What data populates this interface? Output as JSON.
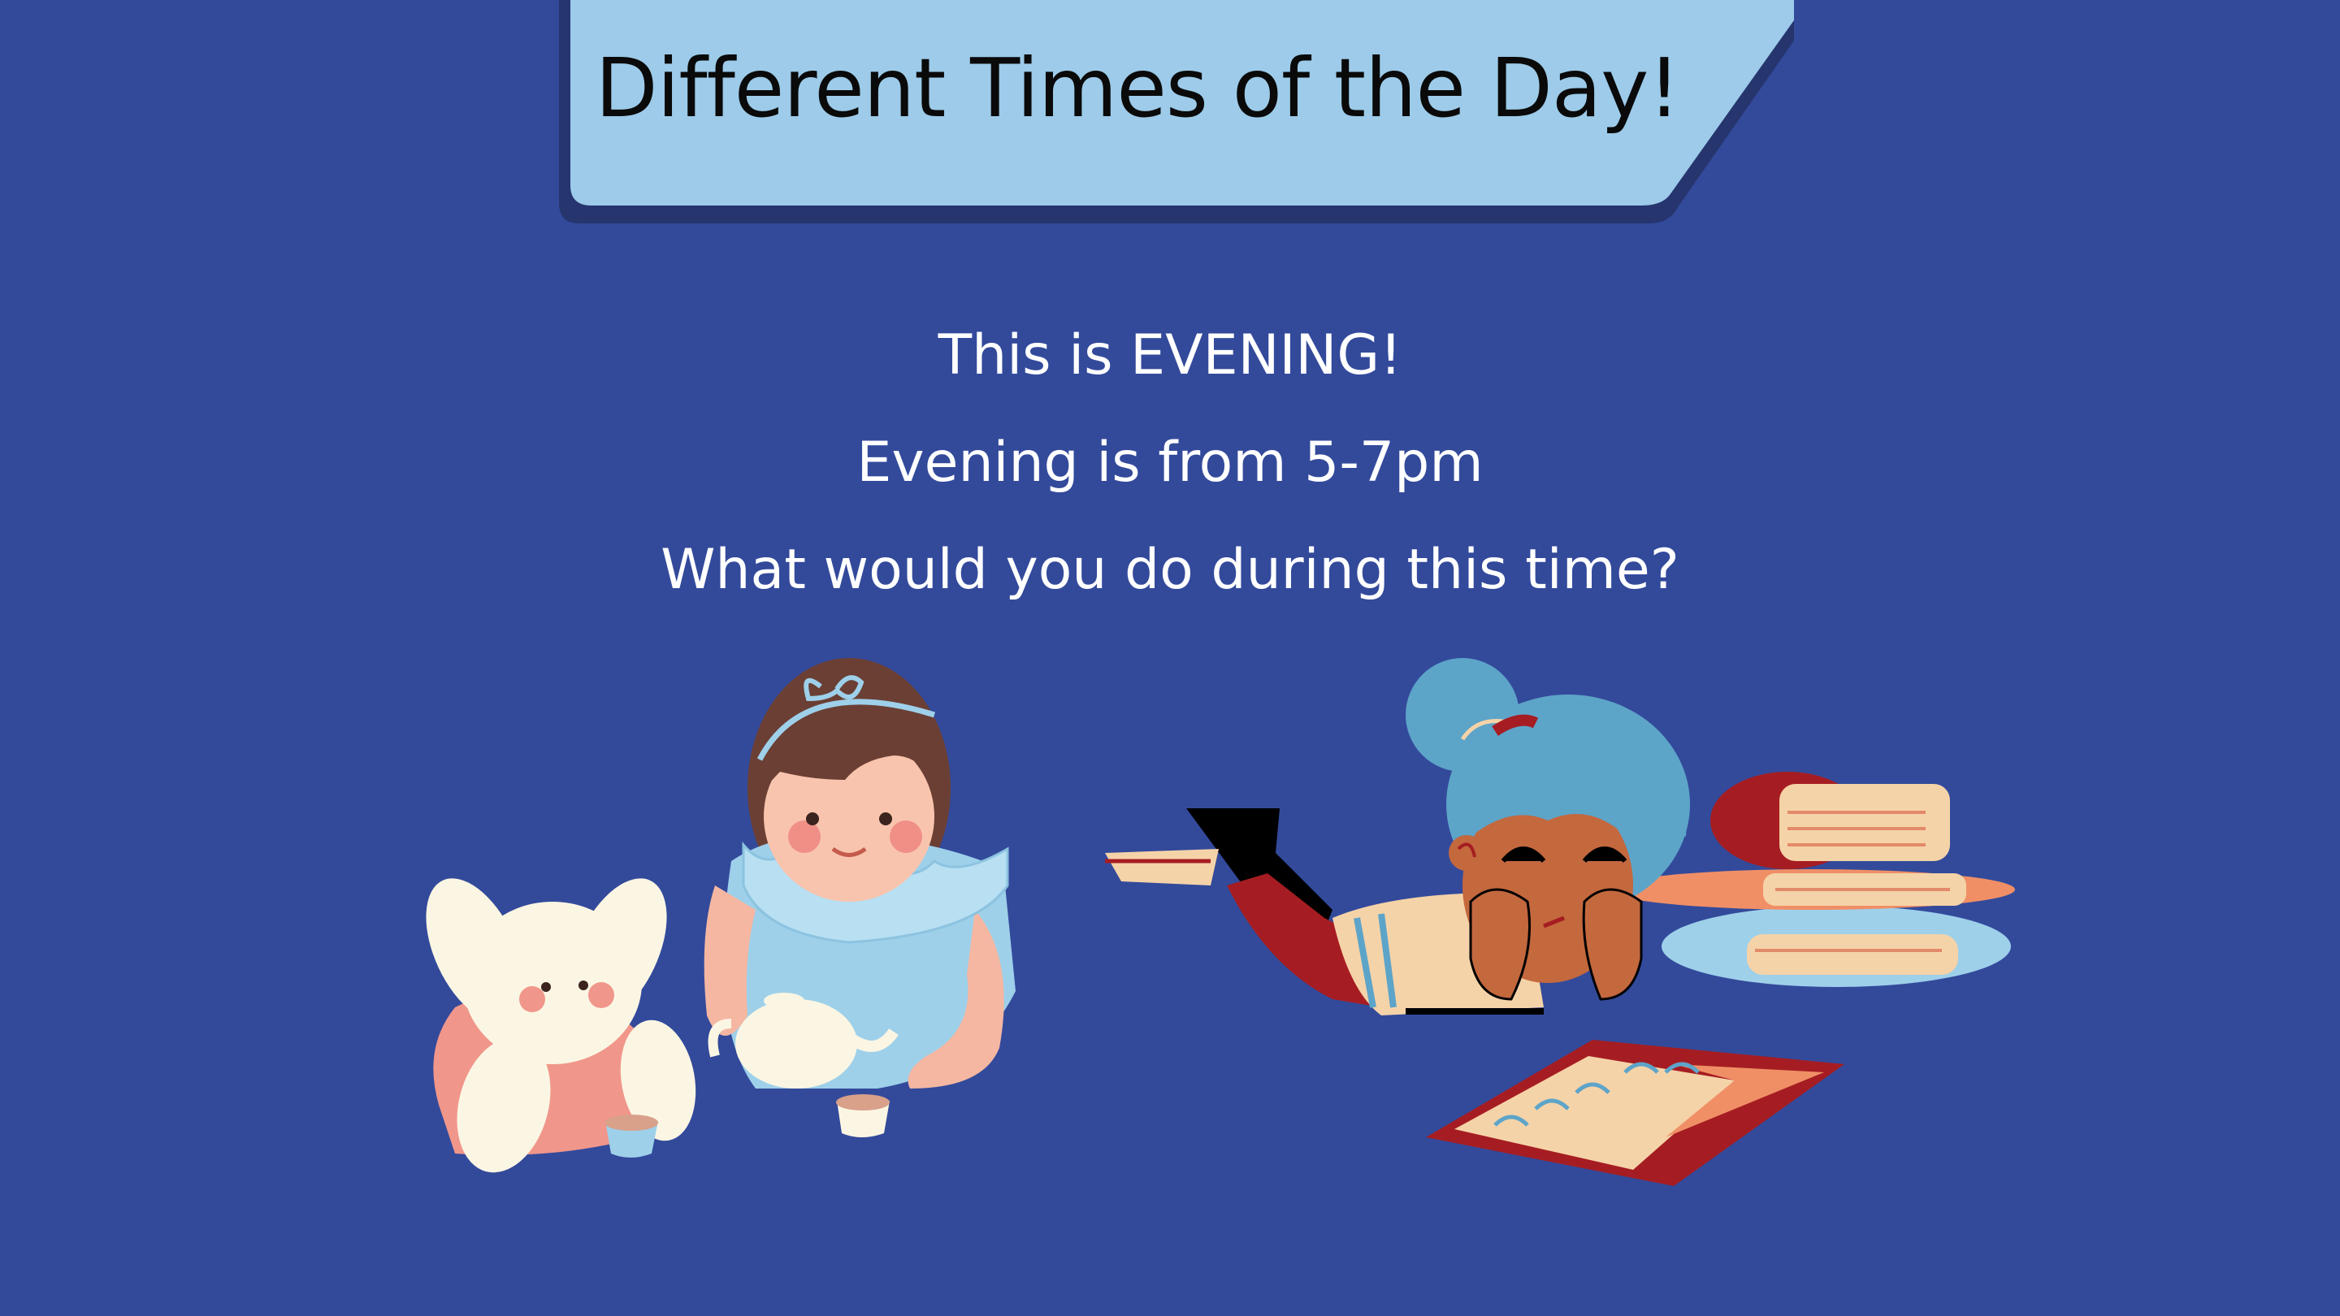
{
  "header": {
    "title": "Different Times of the Day!"
  },
  "content": {
    "lines": [
      "This is EVENING!",
      "Evening is from 5-7pm",
      "What would you do during this time?"
    ]
  },
  "colors": {
    "background": "#334a9b",
    "banner": "#9dcbe9",
    "banner_shadow": "#26356e",
    "text": "#ffffff"
  },
  "illustrations": {
    "left": "girl-tea-party-with-bunny",
    "right": "child-reading-books"
  }
}
